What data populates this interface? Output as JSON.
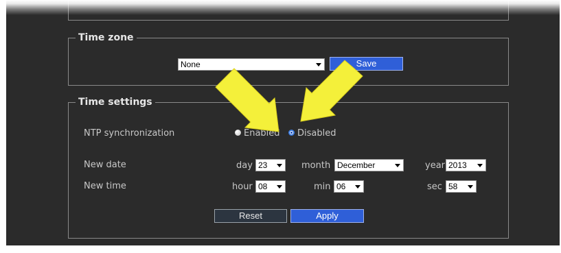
{
  "timezone": {
    "legend": "Time zone",
    "selected": "None",
    "save_label": "Save"
  },
  "time_settings": {
    "legend": "Time settings",
    "ntp": {
      "label": "NTP synchronization",
      "enabled_label": "Enabled",
      "disabled_label": "Disabled",
      "selected": "Disabled"
    },
    "new_date": {
      "label": "New date",
      "day_label": "day",
      "day_value": "23",
      "month_label": "month",
      "month_value": "December",
      "year_label": "year",
      "year_value": "2013"
    },
    "new_time": {
      "label": "New time",
      "hour_label": "hour",
      "hour_value": "08",
      "min_label": "min",
      "min_value": "06",
      "sec_label": "sec",
      "sec_value": "58"
    },
    "reset_label": "Reset",
    "apply_label": "Apply"
  },
  "colors": {
    "background": "#2b2b2b",
    "border": "#8a8a8a",
    "accent_button": "#2f5fd8",
    "annotation_arrow": "#f4f03a"
  },
  "icons": {
    "select_arrow": "chevron-down-icon",
    "annotation": "arrow-annotation-icon"
  }
}
